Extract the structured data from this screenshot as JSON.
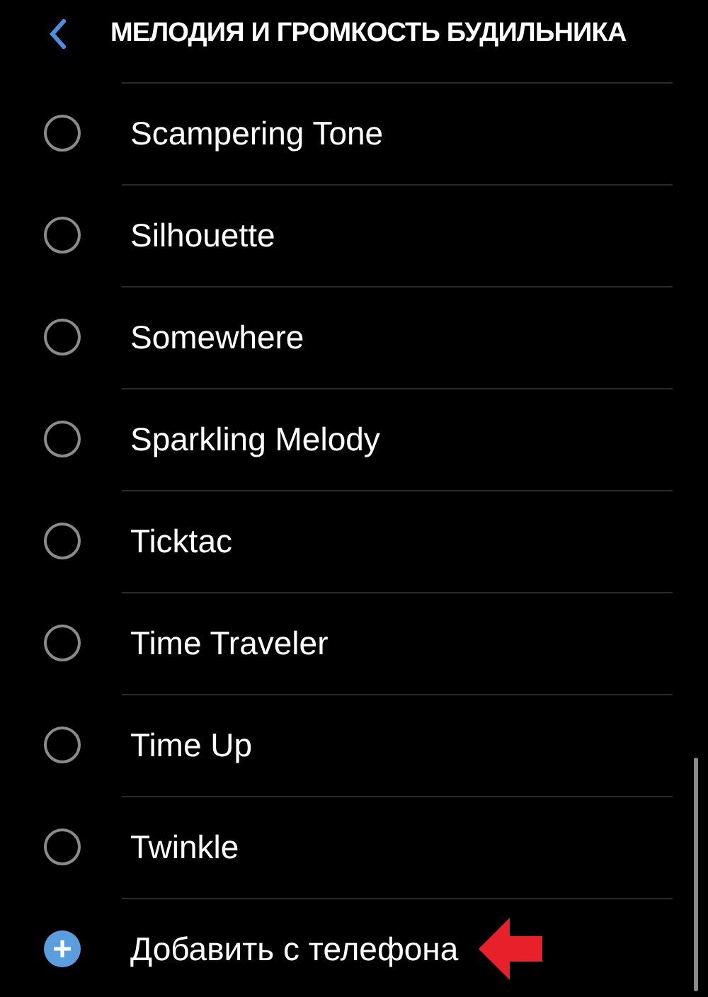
{
  "header": {
    "title": "МЕЛОДИЯ И ГРОМКОСТЬ БУДИЛЬНИКА"
  },
  "items": [
    {
      "kind": "radio",
      "label": "Scampering Tone",
      "selected": false
    },
    {
      "kind": "radio",
      "label": "Silhouette",
      "selected": false
    },
    {
      "kind": "radio",
      "label": "Somewhere",
      "selected": false
    },
    {
      "kind": "radio",
      "label": "Sparkling Melody",
      "selected": false
    },
    {
      "kind": "radio",
      "label": "Ticktac",
      "selected": false
    },
    {
      "kind": "radio",
      "label": "Time Traveler",
      "selected": false
    },
    {
      "kind": "radio",
      "label": "Time Up",
      "selected": false
    },
    {
      "kind": "radio",
      "label": "Twinkle",
      "selected": false
    },
    {
      "kind": "add",
      "label": "Добавить с телефона"
    }
  ]
}
